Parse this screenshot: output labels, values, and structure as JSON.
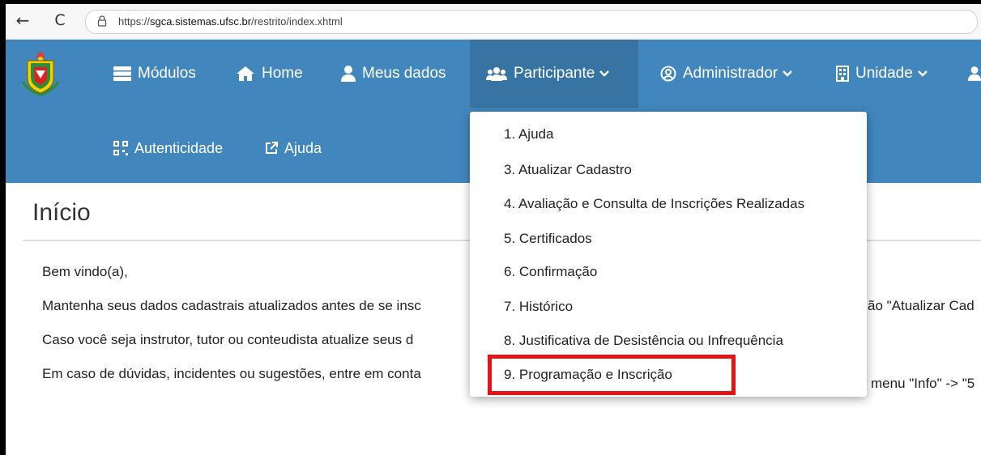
{
  "browser": {
    "back_icon": "←",
    "reload_icon": "C",
    "url_prefix": "https://",
    "url_host": "sgca.sistemas.ufsc.br",
    "url_path": "/restrito/index.xhtml"
  },
  "nav": {
    "modulos": "Módulos",
    "home": "Home",
    "meus_dados": "Meus dados",
    "participante": "Participante",
    "administrador": "Administrador",
    "unidade": "Unidade",
    "autenticidade": "Autenticidade",
    "ajuda": "Ajuda"
  },
  "page": {
    "title": "Início",
    "welcome": "Bem vindo(a),",
    "line1": "Mantenha seus dados cadastrais atualizados antes de se insc",
    "line1_tail": "ão \"Atualizar Cad",
    "line2": "Caso você seja instrutor, tutor ou conteudista atualize seus d",
    "line3": "Em caso de dúvidas, incidentes ou sugestões, entre em conta",
    "line3_tail": "menu \"Info\" -> \"5"
  },
  "participante_menu": [
    "1. Ajuda",
    "3. Atualizar Cadastro",
    "4. Avaliação e Consulta de Inscrições Realizadas",
    "5. Certificados",
    "6. Confirmação",
    "7. Histórico",
    "8. Justificativa de Desistência ou Infrequência",
    "9. Programação e Inscrição"
  ],
  "colors": {
    "header": "#4187bd",
    "active_nav": "#3774a4",
    "highlight": "#e01515"
  }
}
